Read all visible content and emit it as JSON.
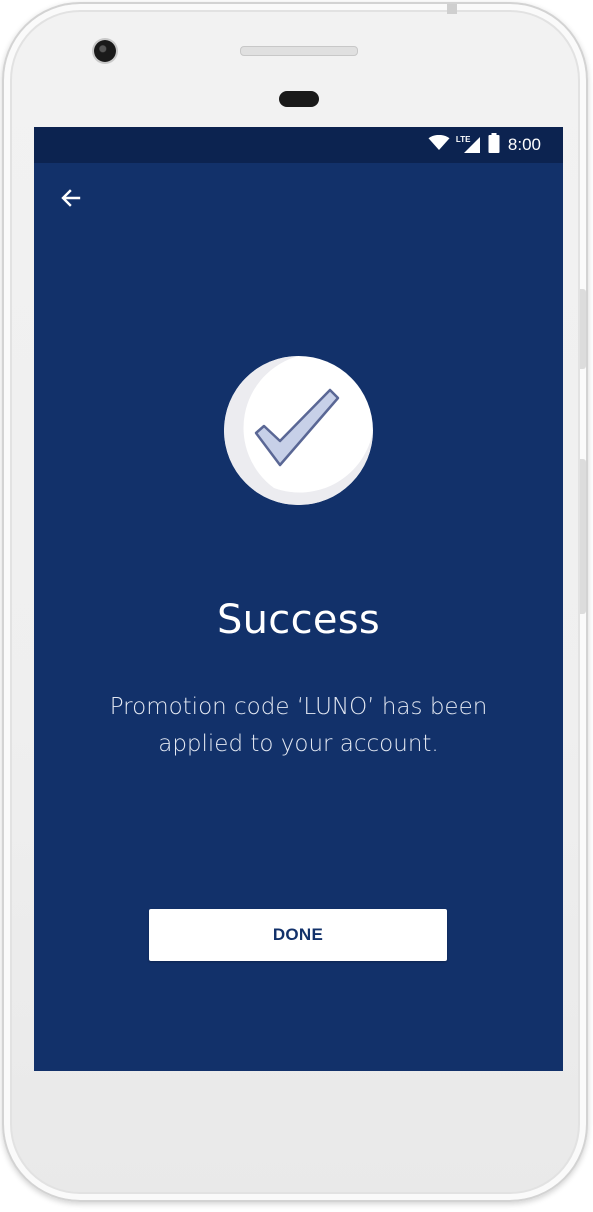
{
  "status_bar": {
    "time": "8:00",
    "network_label": "LTE",
    "icons": [
      "wifi-icon",
      "lte-signal-icon",
      "battery-icon"
    ]
  },
  "toolbar": {
    "back_icon": "arrow-left-icon"
  },
  "success": {
    "icon": "checkmark-icon",
    "title": "Success",
    "message": "Promotion code ‘LUNO’ has been applied to your account."
  },
  "actions": {
    "done_label": "DONE"
  },
  "colors": {
    "screen_background": "#12316a",
    "status_bar_background": "#0c2350",
    "button_background": "#ffffff",
    "button_text": "#12316a",
    "check_fill": "#c7d0e8",
    "check_stroke": "#5a6795"
  }
}
